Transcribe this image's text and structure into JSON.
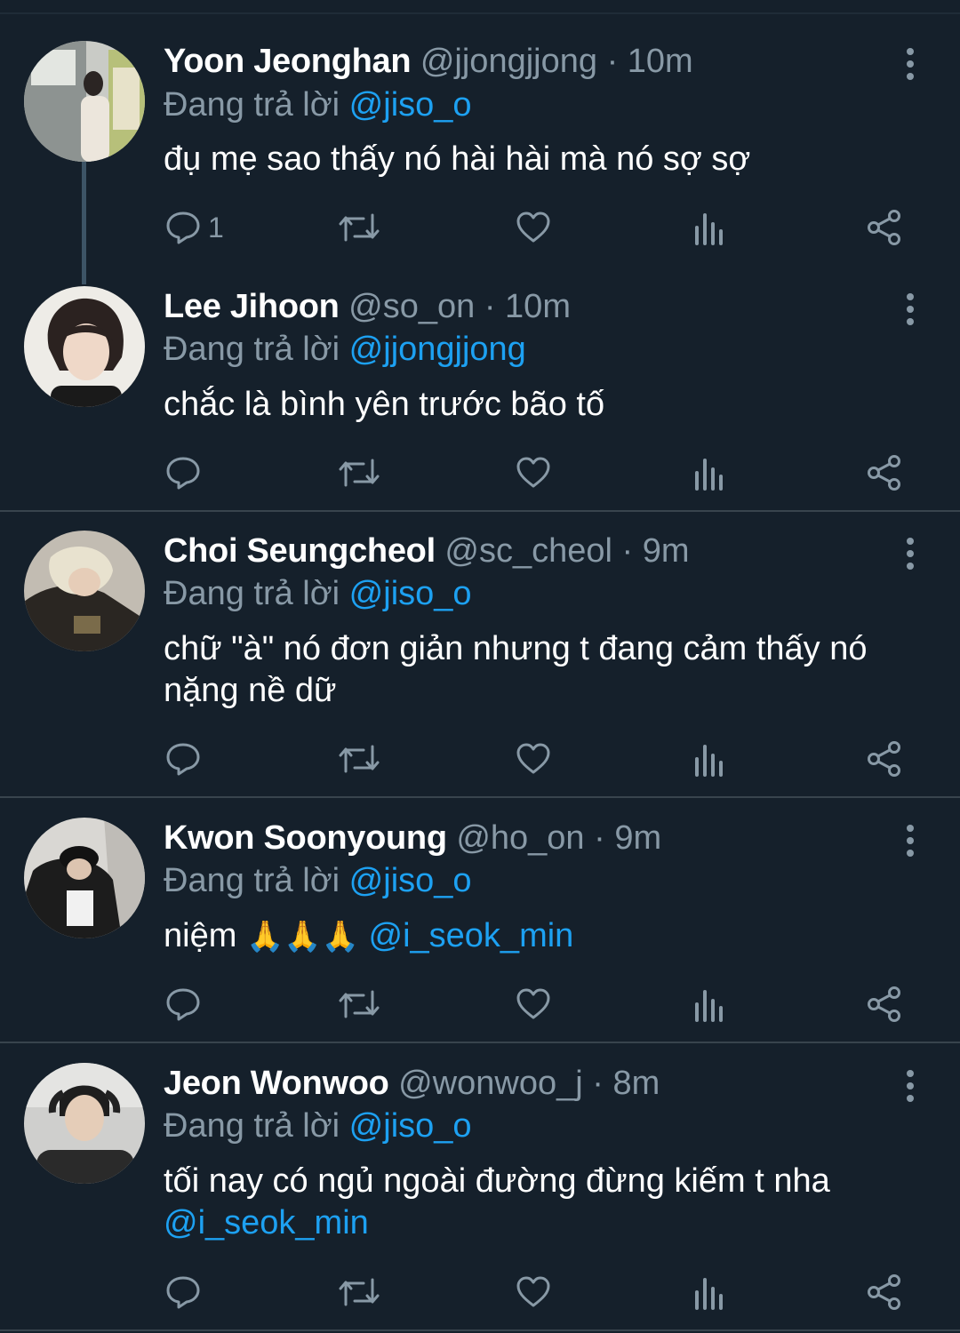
{
  "reply_prefix": "Đang trả lời",
  "tweets": [
    {
      "name": "Yoon Jeonghan",
      "handle": "@jjongjjong",
      "sep": "·",
      "time": "10m",
      "reply_to": "@jiso_o",
      "text": "đụ mẹ sao thấy nó hài hài mà nó sợ sợ",
      "reply_count": "1"
    },
    {
      "name": "Lee Jihoon",
      "handle": "@so_on",
      "sep": "·",
      "time": "10m",
      "reply_to": "@jjongjjong",
      "text": "chắc là bình yên trước bão tố",
      "reply_count": ""
    },
    {
      "name": "Choi Seungcheol",
      "handle": "@sc_cheol",
      "sep": "·",
      "time": "9m",
      "reply_to": "@jiso_o",
      "text": "chữ \"à\" nó đơn giản nhưng t đang cảm thấy nó nặng nề dữ",
      "reply_count": ""
    },
    {
      "name": "Kwon Soonyoung",
      "handle": "@ho_on",
      "sep": "·",
      "time": "9m",
      "reply_to": "@jiso_o",
      "text": "niệm",
      "emoji": "🙏🙏🙏",
      "mention": "@i_seok_min",
      "reply_count": ""
    },
    {
      "name": "Jeon Wonwoo",
      "handle": "@wonwoo_j",
      "sep": "·",
      "time": "8m",
      "reply_to": "@jiso_o",
      "text": "tối nay có ngủ ngoài đường đừng kiếm t nha",
      "mention": "@i_seok_min",
      "reply_count": ""
    }
  ],
  "icons": {
    "reply": "reply-icon",
    "retweet": "retweet-icon",
    "like": "heart-icon",
    "analytics": "analytics-icon",
    "share": "share-icon",
    "more": "more-vertical-icon"
  },
  "colors": {
    "background": "#15202b",
    "muted": "#8899a6",
    "link": "#1da1f2",
    "divider": "#38444d"
  }
}
